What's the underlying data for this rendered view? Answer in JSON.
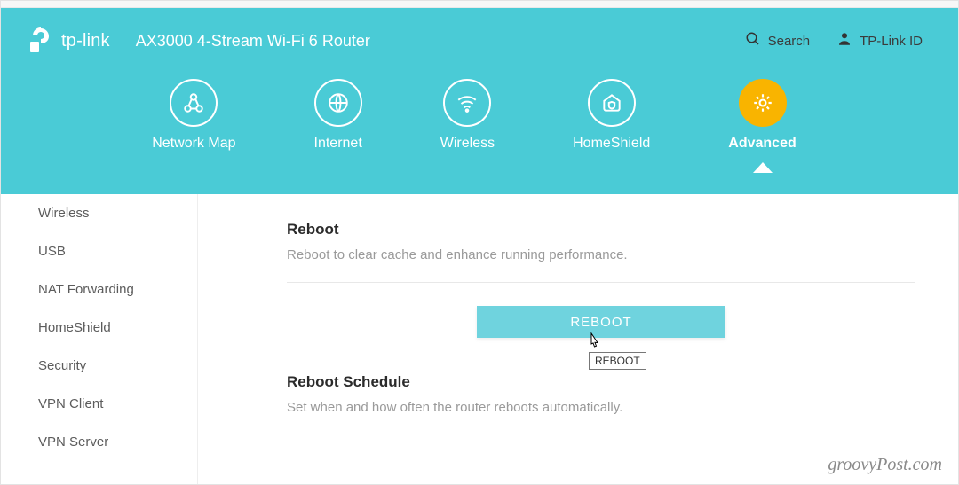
{
  "header": {
    "brand": "tp-link",
    "product": "AX3000 4-Stream Wi-Fi 6 Router",
    "search_label": "Search",
    "id_label": "TP-Link ID"
  },
  "nav": {
    "items": [
      {
        "label": "Network Map",
        "icon": "network"
      },
      {
        "label": "Internet",
        "icon": "globe"
      },
      {
        "label": "Wireless",
        "icon": "wifi"
      },
      {
        "label": "HomeShield",
        "icon": "shield"
      },
      {
        "label": "Advanced",
        "icon": "gear",
        "active": true
      }
    ]
  },
  "sidebar": {
    "items": [
      {
        "label": "Wireless"
      },
      {
        "label": "USB"
      },
      {
        "label": "NAT Forwarding"
      },
      {
        "label": "HomeShield"
      },
      {
        "label": "Security"
      },
      {
        "label": "VPN Client"
      },
      {
        "label": "VPN Server"
      }
    ]
  },
  "main": {
    "reboot_title": "Reboot",
    "reboot_desc": "Reboot to clear cache and enhance running performance.",
    "reboot_button": "REBOOT",
    "reboot_tooltip": "REBOOT",
    "schedule_title": "Reboot Schedule",
    "schedule_desc": "Set when and how often the router reboots automatically."
  },
  "watermark": "groovyPost.com"
}
